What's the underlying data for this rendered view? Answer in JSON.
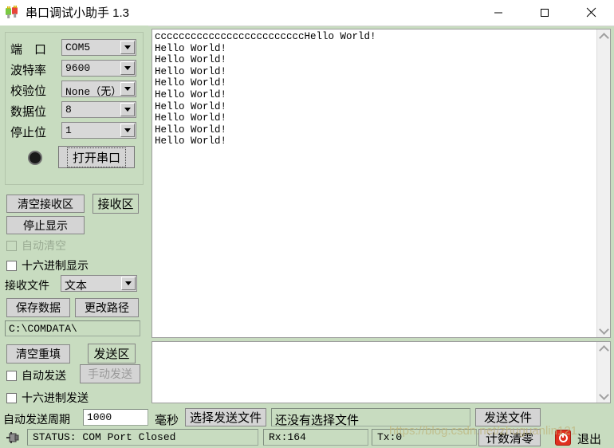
{
  "window": {
    "title": "串口调试小助手 1.3",
    "icon": "serial-plug-icon",
    "minimize": "–",
    "maximize": "□",
    "close": "✕"
  },
  "params": [
    {
      "label": "端　口",
      "value": "COM5",
      "name": "port"
    },
    {
      "label": "波特率",
      "value": "9600",
      "name": "baud-rate"
    },
    {
      "label": "校验位",
      "value": "None（无）",
      "name": "parity"
    },
    {
      "label": "数据位",
      "value": "8",
      "name": "data-bits"
    },
    {
      "label": "停止位",
      "value": "1",
      "name": "stop-bits"
    }
  ],
  "open_port_button": "打开串口",
  "receive_panel": {
    "clear_button": "清空接收区",
    "section_label": "接收区",
    "stop_display_button": "停止显示",
    "auto_clear_label": "自动清空",
    "hex_display_label": "十六进制显示",
    "recv_file_label": "接收文件",
    "recv_file_value": "文本",
    "save_data_button": "保存数据",
    "change_path_button": "更改路径",
    "path_value": "C:\\COMDATA\\"
  },
  "send_panel": {
    "clear_refill_button": "清空重填",
    "section_label": "发送区",
    "auto_send_label": "自动发送",
    "manual_send_button": "手动发送",
    "hex_send_label": "十六进制发送",
    "period_label": "自动发送周期",
    "period_value": "1000",
    "period_unit": "毫秒",
    "choose_file_button": "选择发送文件",
    "file_status": "还没有选择文件",
    "send_file_button": "发送文件"
  },
  "receive_text": "cccccccccccccccccccccccccHello World!\nHello World!\nHello World!\nHello World!\nHello World!\nHello World!\nHello World!\nHello World!\nHello World!\nHello World!",
  "send_text": "",
  "status": {
    "icon": "plug-icon",
    "message": "STATUS: COM Port Closed",
    "rx": "Rx:164",
    "tx": "Tx:0",
    "reset_counter_button": "计数清零",
    "exit_button": "退出",
    "exit_icon": "power-icon"
  },
  "watermark": "https://blog.csdn.net/zhuguanlin121",
  "colors": {
    "window_background": "#c8dcc0",
    "button_face": "#d4d4d4",
    "text_area": "#ffffff",
    "exit_icon": "#e03020"
  }
}
